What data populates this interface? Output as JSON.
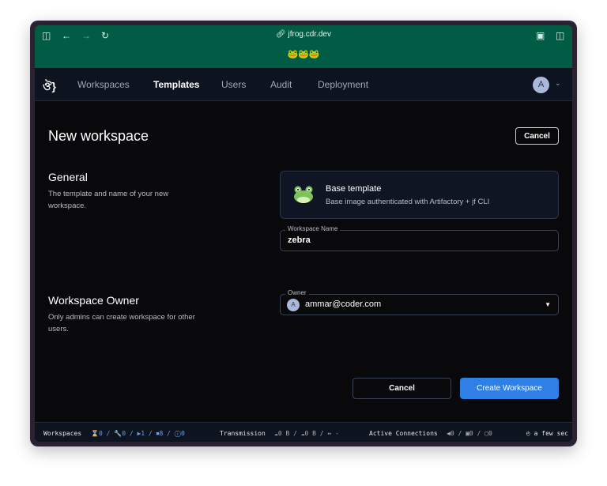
{
  "browser": {
    "url": "jfrog.cdr.dev",
    "banner": "🐸🐸🐸"
  },
  "nav": {
    "items": [
      "Workspaces",
      "Templates",
      "Users",
      "Audit",
      "Deployment"
    ],
    "active": "Templates",
    "avatar": "A"
  },
  "page": {
    "title": "New workspace",
    "cancel": "Cancel"
  },
  "general": {
    "heading": "General",
    "description": "The template and name of your new workspace.",
    "template": {
      "name": "Base template",
      "description": "Base image authenticated with Artifactory + jf CLI"
    },
    "name_field": {
      "label": "Workspace Name",
      "value": "zebra"
    }
  },
  "owner": {
    "heading": "Workspace Owner",
    "description": "Only admins can create workspace for other users.",
    "field": {
      "label": "Owner",
      "avatar": "A",
      "value": "ammar@coder.com"
    }
  },
  "actions": {
    "cancel": "Cancel",
    "create": "Create Workspace"
  },
  "statusbar": {
    "workspaces_label": "Workspaces",
    "workspaces": "⌛0 / 🔧0 / ▶1 / ⏹8 / ⓘ0",
    "transmission_label": "Transmission",
    "transmission": "☁0 B / ☁0 B / ↔ -",
    "connections_label": "Active Connections",
    "connections": "◀0 / ▣0 / ▢0",
    "updated": "a few sec"
  },
  "colors": {
    "brand_green": "#005c45",
    "primary": "#2f7fe6"
  }
}
